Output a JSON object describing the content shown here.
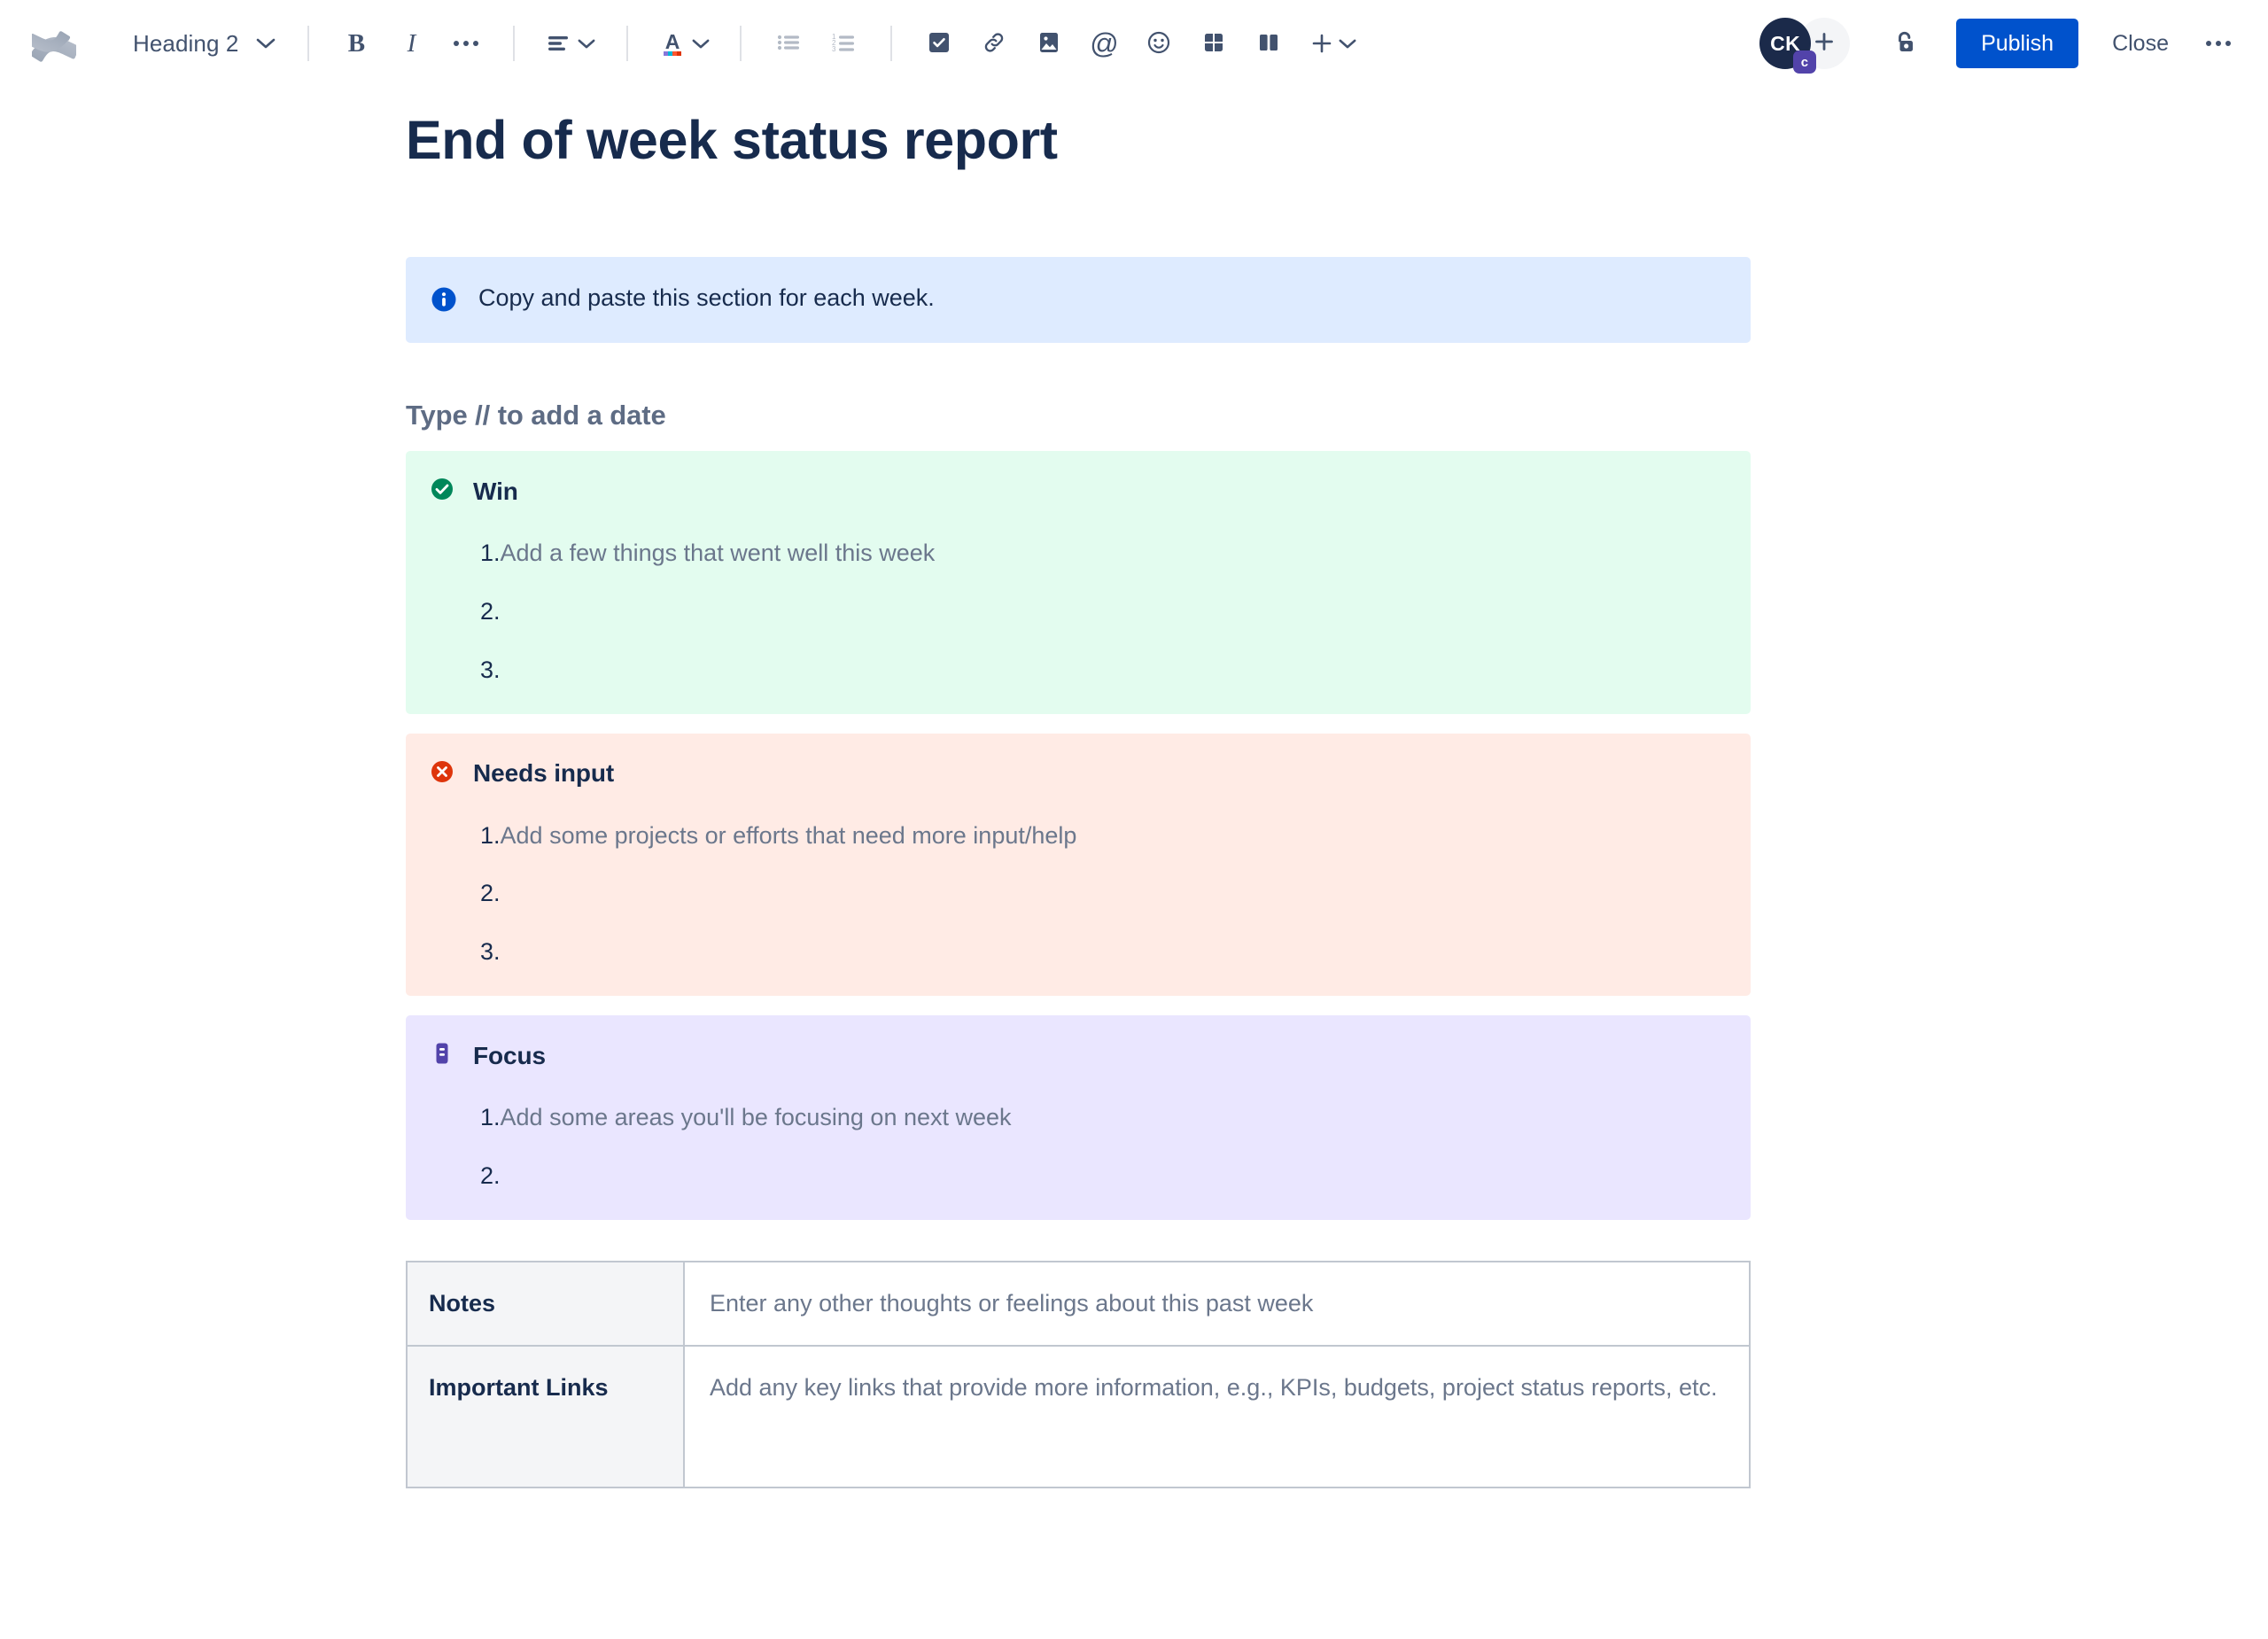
{
  "toolbar": {
    "logo_icon": "confluence-logo-icon",
    "style_select": {
      "value": "Heading 2",
      "chevron_icon": "chevron-down-icon"
    },
    "buttons": [
      {
        "name": "bold-button",
        "icon": "bold-icon",
        "glyph": "B"
      },
      {
        "name": "italic-button",
        "icon": "italic-icon",
        "glyph": "I"
      },
      {
        "name": "more-formatting-button",
        "icon": "ellipsis-icon",
        "glyph": "…"
      },
      {
        "name": "text-align-button",
        "icon": "text-align-left-icon",
        "glyph": ""
      },
      {
        "name": "text-color-button",
        "icon": "text-color-icon",
        "glyph": "A"
      },
      {
        "name": "bulleted-list-button",
        "icon": "bulleted-list-icon",
        "glyph": ""
      },
      {
        "name": "numbered-list-button",
        "icon": "numbered-list-icon",
        "glyph": ""
      },
      {
        "name": "task-list-button",
        "icon": "checkbox-icon",
        "glyph": ""
      },
      {
        "name": "link-button",
        "icon": "link-icon",
        "glyph": ""
      },
      {
        "name": "image-button",
        "icon": "image-icon",
        "glyph": ""
      },
      {
        "name": "mention-button",
        "icon": "mention-at-icon",
        "glyph": "@"
      },
      {
        "name": "emoji-button",
        "icon": "emoji-smiley-icon",
        "glyph": ""
      },
      {
        "name": "table-button",
        "icon": "table-icon",
        "glyph": ""
      },
      {
        "name": "layout-button",
        "icon": "columns-layout-icon",
        "glyph": ""
      },
      {
        "name": "insert-more-button",
        "icon": "plus-icon",
        "glyph": "+"
      }
    ],
    "avatar": {
      "initials": "CK",
      "badge": "c",
      "badge_color": "#5243AA",
      "bg_color": "#1B2A4A"
    },
    "add_people_icon": "plus-icon",
    "restrictions_icon": "unlocked-padlock-icon",
    "publish_label": "Publish",
    "publish_color": "#0052CC",
    "close_label": "Close",
    "more_actions_icon": "ellipsis-icon"
  },
  "document": {
    "title": "End of week status report",
    "info_panel": {
      "icon": "info-circle-icon",
      "icon_color": "#0052CC",
      "bg_color": "#DEEBFF",
      "text": "Copy and paste this section for each week."
    },
    "section_heading": "Type // to add a date",
    "panels": [
      {
        "id": "win",
        "title": "Win",
        "icon": "check-circle-icon",
        "icon_color": "#00875A",
        "bg_color": "#E3FCEF",
        "items": [
          {
            "num": "1.",
            "text": "Add a few things that went well this week"
          },
          {
            "num": "2.",
            "text": ""
          },
          {
            "num": "3.",
            "text": ""
          }
        ]
      },
      {
        "id": "needs-input",
        "title": "Needs input",
        "icon": "error-cross-circle-icon",
        "icon_color": "#DE350B",
        "bg_color": "#FFEBE5",
        "items": [
          {
            "num": "1.",
            "text": "Add some projects or efforts that need more input/help"
          },
          {
            "num": "2.",
            "text": ""
          },
          {
            "num": "3.",
            "text": ""
          }
        ]
      },
      {
        "id": "focus",
        "title": "Focus",
        "icon": "note-board-icon",
        "icon_color": "#5243AA",
        "bg_color": "#EAE6FF",
        "items": [
          {
            "num": "1.",
            "text": "Add some areas you'll be focusing on next week"
          },
          {
            "num": "2.",
            "text": ""
          }
        ]
      }
    ],
    "table": {
      "rows": [
        {
          "header": "Notes",
          "value": "Enter any other thoughts or feelings about this past week"
        },
        {
          "header": "Important Links",
          "value": "Add any key links that provide more information, e.g., KPIs, budgets, project status reports, etc."
        }
      ]
    }
  }
}
